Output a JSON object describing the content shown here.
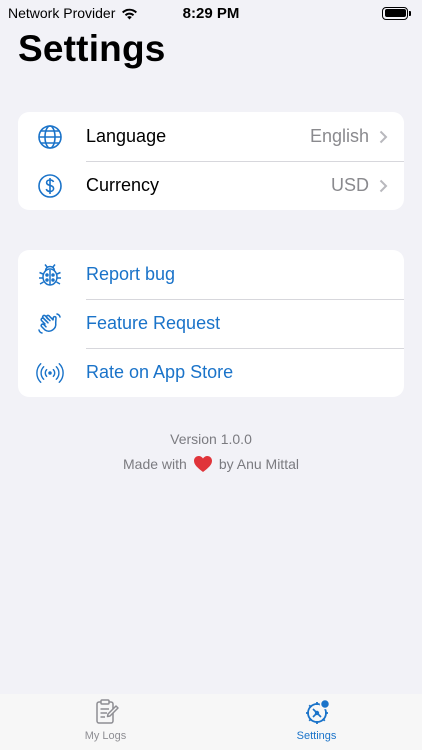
{
  "status_bar": {
    "carrier": "Network Provider",
    "time": "8:29 PM"
  },
  "page": {
    "title": "Settings"
  },
  "preferences": [
    {
      "icon": "globe-icon",
      "label": "Language",
      "value": "English"
    },
    {
      "icon": "dollar-circle-icon",
      "label": "Currency",
      "value": "USD"
    }
  ],
  "support": [
    {
      "icon": "ladybug-icon",
      "label": "Report bug"
    },
    {
      "icon": "waving-hand-icon",
      "label": "Feature Request"
    },
    {
      "icon": "broadcast-icon",
      "label": "Rate on App Store"
    }
  ],
  "footer": {
    "version": "Version 1.0.0",
    "made_prefix": "Made with",
    "made_suffix": "by Anu Mittal"
  },
  "tabs": [
    {
      "icon": "notepad-icon",
      "label": "My Logs",
      "active": false
    },
    {
      "icon": "settings-gear-icon",
      "label": "Settings",
      "active": true
    }
  ],
  "colors": {
    "accent": "#1a73c9",
    "background": "#f2f2f7",
    "secondary_text": "#8a8a8e",
    "heart": "#e0343a"
  }
}
